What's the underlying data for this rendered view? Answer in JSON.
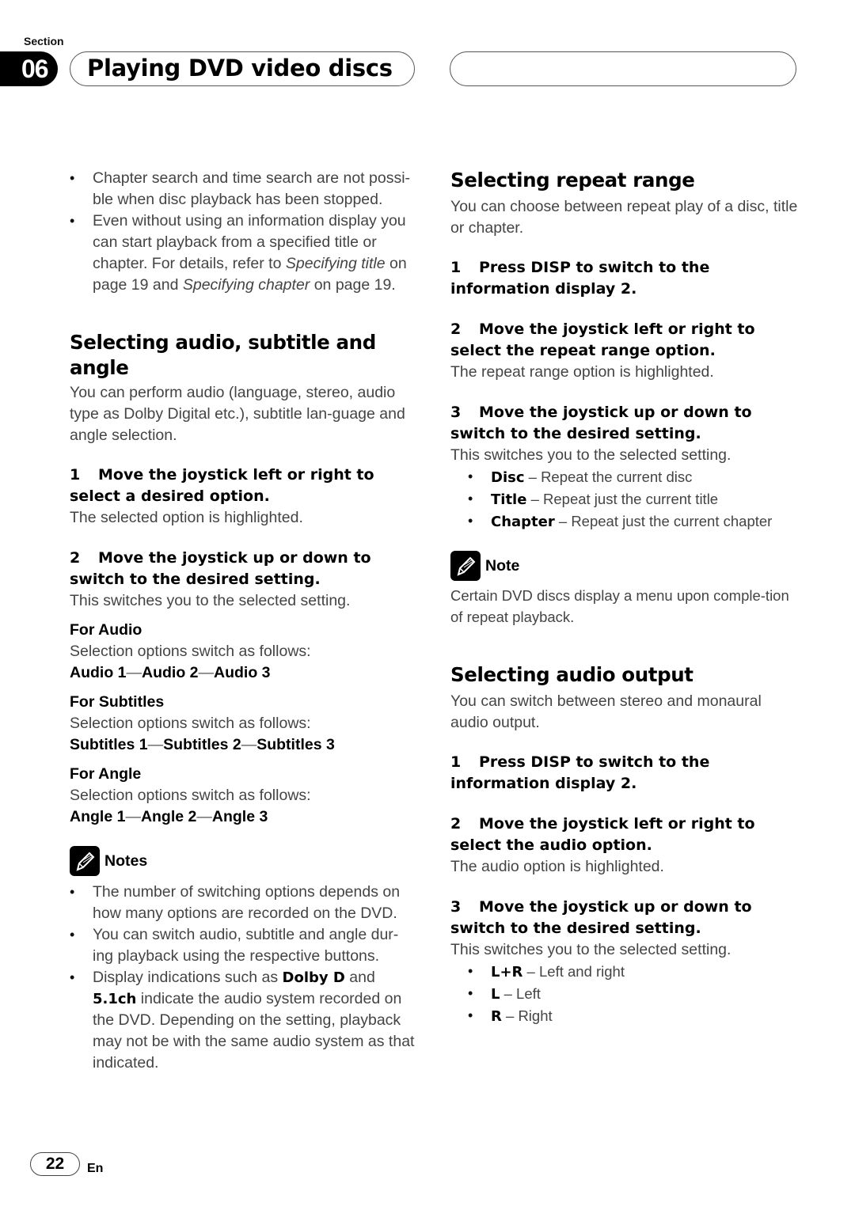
{
  "header": {
    "section_label": "Section",
    "section_number": "06",
    "title": "Playing DVD video discs"
  },
  "left": {
    "intro_bullets": [
      {
        "text": "Chapter search and time search are not possi-ble when disc playback has been stopped."
      },
      {
        "pre": "Even without using an information display you can start playback from a specified title or chapter. For details, refer to ",
        "ref1": "Specifying title",
        "mid": " on page 19 and ",
        "ref2": "Specifying chapter",
        "post": " on page 19."
      }
    ],
    "section_audio": {
      "heading": "Selecting audio, subtitle and angle",
      "intro": "You can perform audio (language, stereo, audio type as Dolby Digital etc.), subtitle lan-guage and angle selection.",
      "steps": [
        {
          "num": "1",
          "text": "Move the joystick left or right to select a desired option.",
          "result": "The selected option is highlighted."
        },
        {
          "num": "2",
          "text": "Move the joystick up or down to switch to the desired setting.",
          "result": "This switches you to the selected setting."
        }
      ],
      "groups": [
        {
          "heading": "For Audio",
          "desc": "Selection options switch as follows:",
          "seq": [
            "Audio 1",
            "Audio 2",
            "Audio 3"
          ]
        },
        {
          "heading": "For Subtitles",
          "desc": "Selection options switch as follows:",
          "seq": [
            "Subtitles 1",
            "Subtitles 2",
            "Subtitles 3"
          ]
        },
        {
          "heading": "For Angle",
          "desc": "Selection options switch as follows:",
          "seq": [
            "Angle 1",
            "Angle 2",
            "Angle 3"
          ]
        }
      ],
      "seq_separator": "—",
      "notes_title": "Notes",
      "notes": [
        {
          "text": "The number of switching options depends on how many options are recorded on the DVD."
        },
        {
          "text": "You can switch audio, subtitle and angle dur-ing playback using the respective buttons."
        },
        {
          "pre": "Display indications such as ",
          "b1": "Dolby D",
          "mid": " and ",
          "b2": "5.1ch",
          "post": " indicate the audio system recorded on the DVD. Depending on the setting, playback may not be with the same audio system as that indicated."
        }
      ]
    }
  },
  "right": {
    "section_repeat": {
      "heading": "Selecting repeat range",
      "intro": "You can choose between repeat play of a disc, title or chapter.",
      "steps": [
        {
          "num": "1",
          "text": "Press DISP to switch to the information display 2.",
          "result": ""
        },
        {
          "num": "2",
          "text": "Move the joystick left or right to select the repeat range option.",
          "result": "The repeat range option is highlighted."
        },
        {
          "num": "3",
          "text": "Move the joystick up or down to switch to the desired setting.",
          "result": "This switches you to the selected setting."
        }
      ],
      "options": [
        {
          "key": "Disc",
          "desc": " – Repeat the current disc"
        },
        {
          "key": "Title",
          "desc": " – Repeat just the current title"
        },
        {
          "key": "Chapter",
          "desc": " – Repeat just the current chapter"
        }
      ],
      "note_title": "Note",
      "note": "Certain DVD discs display a menu upon comple-tion of repeat playback."
    },
    "section_output": {
      "heading": "Selecting audio output",
      "intro": "You can switch between stereo and monaural audio output.",
      "steps": [
        {
          "num": "1",
          "text": "Press DISP to switch to the information display 2.",
          "result": ""
        },
        {
          "num": "2",
          "text": "Move the joystick left or right to select the audio option.",
          "result": "The audio option is highlighted."
        },
        {
          "num": "3",
          "text": "Move the joystick up or down to switch to the desired setting.",
          "result": "This switches you to the selected setting."
        }
      ],
      "options": [
        {
          "key": "L+R",
          "desc": " – Left and right"
        },
        {
          "key": "L",
          "desc": " – Left"
        },
        {
          "key": "R",
          "desc": " – Right"
        }
      ]
    }
  },
  "footer": {
    "page_number": "22",
    "language": "En"
  }
}
